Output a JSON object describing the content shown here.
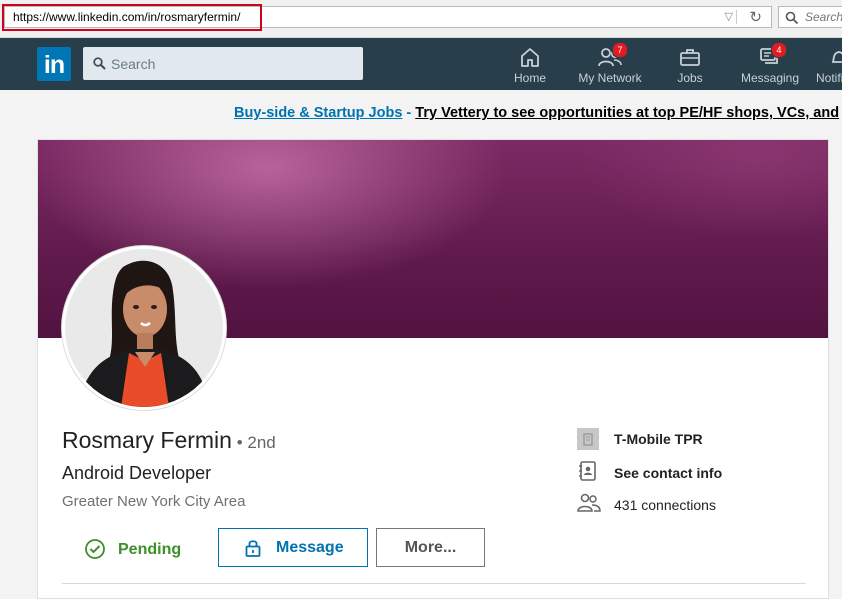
{
  "browser": {
    "url": "https://www.linkedin.com/in/rosmaryfermin/",
    "search_placeholder": "Search"
  },
  "nav": {
    "search_placeholder": "Search",
    "items": [
      {
        "label": "Home",
        "icon": "home-icon"
      },
      {
        "label": "My Network",
        "icon": "network-icon",
        "badge": "7"
      },
      {
        "label": "Jobs",
        "icon": "briefcase-icon"
      },
      {
        "label": "Messaging",
        "icon": "messaging-icon",
        "badge": "4"
      },
      {
        "label": "Notifi",
        "icon": "bell-icon"
      }
    ]
  },
  "ad": {
    "link": "Buy-side & Startup Jobs",
    "separator": " - ",
    "text": "Try Vettery to see opportunities at top PE/HF shops, VCs, and"
  },
  "profile": {
    "name": "Rosmary Fermin",
    "degree": " • 2nd",
    "headline": "Android Developer",
    "location": "Greater New York City Area",
    "company": "T-Mobile TPR",
    "contact": "See contact info",
    "connections": "431 connections"
  },
  "actions": {
    "pending": "Pending",
    "message": "Message",
    "more": "More..."
  },
  "colors": {
    "nav_bg": "#283e4a",
    "brand": "#0077b5",
    "link": "#0073b1",
    "pending": "#3d8f2a",
    "badge": "#e31b23",
    "banner": "#6b2257"
  }
}
